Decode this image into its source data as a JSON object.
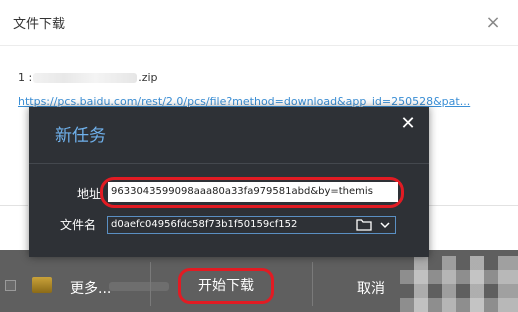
{
  "background_dialog": {
    "title": "文件下载",
    "close_glyph": "×",
    "file_index": "1 :",
    "file_ext": ".zip",
    "link_text": "https://pcs.baidu.com/rest/2.0/pcs/file?method=download&app_id=250528&pat..."
  },
  "task_dialog": {
    "title": "新任务",
    "close_glyph": "✕",
    "address_label": "地址",
    "address_value": "9633043599098aaa80a33fa979581abd&by=themis",
    "filename_label": "文件名",
    "filename_value": "d0aefc04956fdc58f73b1f50159cf152"
  },
  "bottom_bar": {
    "more_label": "更多...",
    "start_label": "开始下载",
    "cancel_label": "取消"
  },
  "colors": {
    "dialog_bg": "#2e3136",
    "title_accent": "#6fb1ec",
    "highlight_red": "#e21b23",
    "link_blue": "#3b8fd6",
    "bottom_bar_bg": "#5f5f5f"
  },
  "icons": [
    "close-icon",
    "folder-icon",
    "chevron-down-icon",
    "app-icon"
  ]
}
